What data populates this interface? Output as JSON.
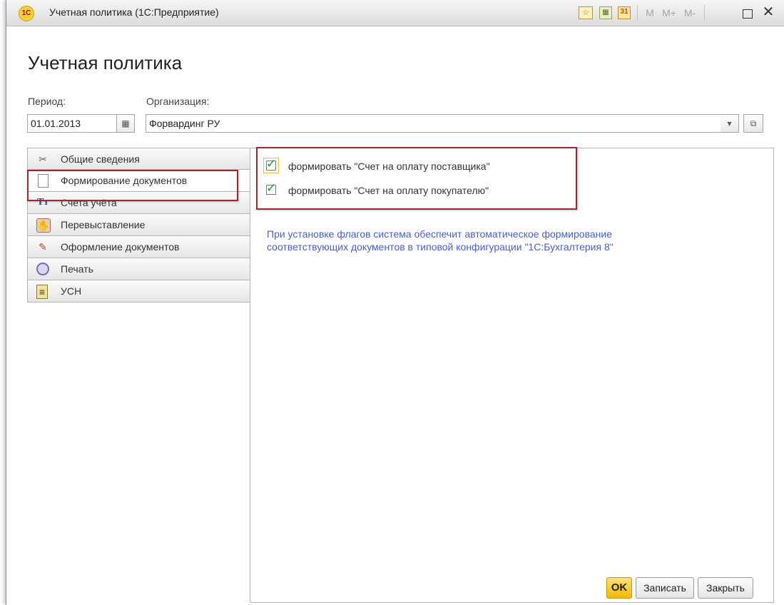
{
  "window": {
    "title": "Учетная политика  (1С:Предприятие)",
    "logo_text": "1С",
    "toolbar": {
      "fav_icon": "☆",
      "calc_icon": "▦",
      "calendar_icon": "31",
      "m_label": "M",
      "mplus_label": "M+",
      "mminus_label": "M-",
      "maximize_icon": "",
      "close_icon": "✕"
    }
  },
  "form": {
    "heading": "Учетная политика",
    "period_label": "Период:",
    "period_value": "01.01.2013",
    "org_label": "Организация:",
    "org_value": "Форвардинг РУ",
    "dropdown_icon": "▾",
    "open_icon": "⧉",
    "calendar_icon": "▦"
  },
  "tabs": [
    {
      "label": "Общие сведения",
      "icon": "tools-icon",
      "glyph": "✂"
    },
    {
      "label": "Формирование документов",
      "icon": "document-icon",
      "glyph": ""
    },
    {
      "label": "Счета учёта",
      "icon": "accounts-icon",
      "glyph": "Тт"
    },
    {
      "label": "Перевыставление",
      "icon": "hand-icon",
      "glyph": "✋"
    },
    {
      "label": "Оформление документов",
      "icon": "pen-icon",
      "glyph": "✎"
    },
    {
      "label": "Печать",
      "icon": "print-icon",
      "glyph": ""
    },
    {
      "label": "УСН",
      "icon": "usn-icon",
      "glyph": "≡"
    }
  ],
  "active_tab": "Формирование документов",
  "panel": {
    "checkbox1_label": "формировать \"Счет на оплату поставщика\"",
    "checkbox1_checked": true,
    "checkbox2_label": "формировать \"Счет на оплату покупателю\"",
    "checkbox2_checked": true,
    "check_mark": "✓",
    "hint_line1": "При установке флагов система обеспечит автоматическое формирование",
    "hint_line2": "соответствующих документов в типовой конфигурации \"1С:Бухгалтерия 8\""
  },
  "buttons": {
    "ok": "OK",
    "save": "Записать",
    "close": "Закрыть"
  },
  "colors": {
    "accent_yellow": "#f0b800",
    "highlight_red": "#a3262e",
    "hint_blue": "#4a60c8",
    "check_green": "#1f9a2f"
  }
}
